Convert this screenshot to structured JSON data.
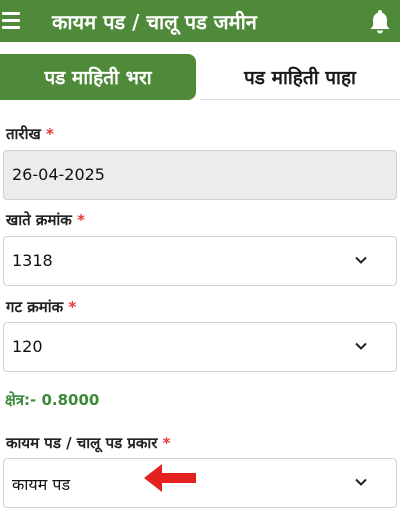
{
  "appbar": {
    "title": "कायम पड / चालू पड जमीन"
  },
  "tabs": [
    {
      "label": "पड माहिती भरा",
      "active": true
    },
    {
      "label": "पड माहिती पाहा",
      "active": false
    }
  ],
  "form": {
    "required_mark": "*",
    "date": {
      "label": "तारीख",
      "value": "26-04-2025"
    },
    "khate": {
      "label": "खाते क्रमांक",
      "value": "1318"
    },
    "gat": {
      "label": "गट क्रमांक",
      "value": "120"
    },
    "area": {
      "text": "क्षेत्र:- 0.8000"
    },
    "type": {
      "label": "कायम पड / चालू पड प्रकार",
      "value": "कायम पड"
    }
  },
  "colors": {
    "primary": "#4f8a3a",
    "required": "#e53935",
    "area_text": "#3e8a3a",
    "arrow": "#e32121"
  },
  "icons": {
    "menu": "menu-icon",
    "bell": "bell-icon",
    "dropdown": "chevron-down-icon",
    "annotation": "red-arrow-icon"
  }
}
